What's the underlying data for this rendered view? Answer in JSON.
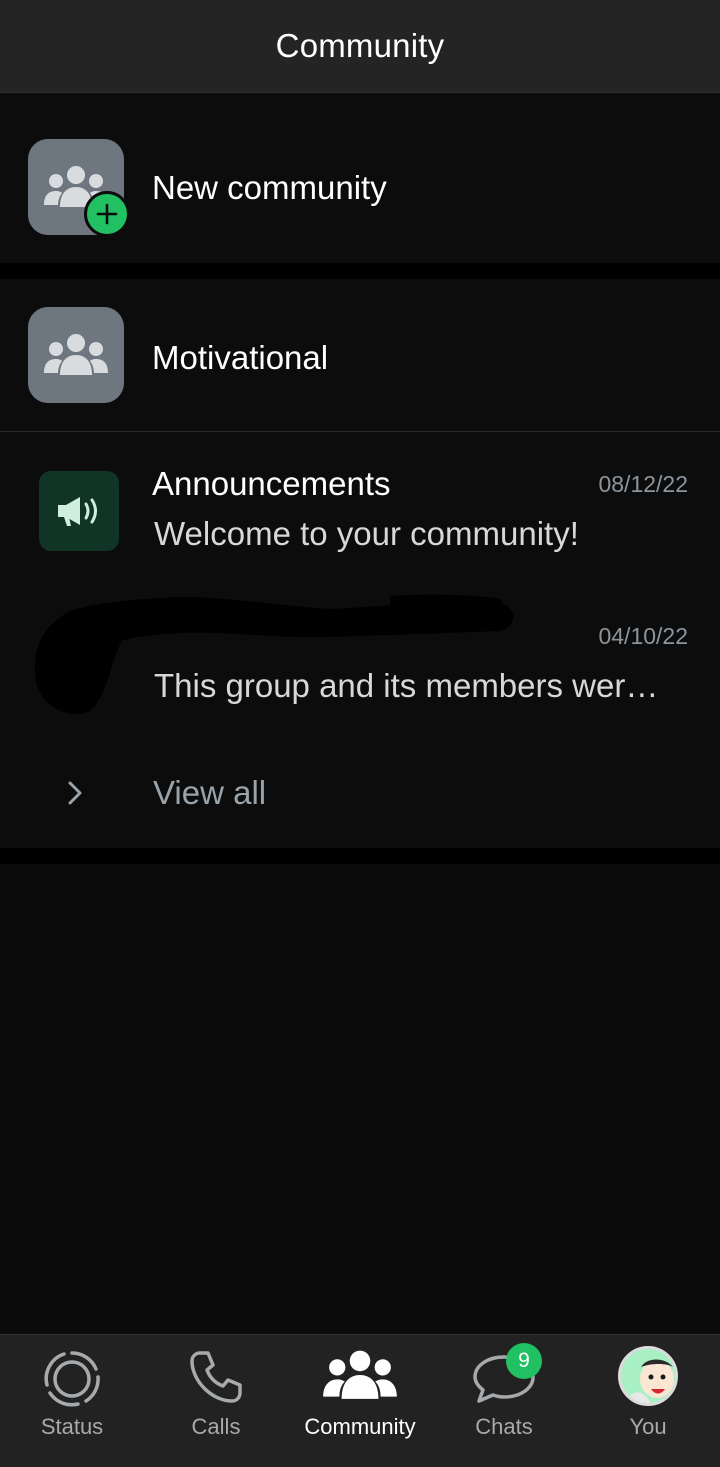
{
  "header": {
    "title": "Community"
  },
  "new_community": {
    "label": "New community",
    "icon": "community-plus-icon"
  },
  "community": {
    "name": "Motivational",
    "groups": [
      {
        "title": "Announcements",
        "date": "08/12/22",
        "message": "Welcome to your community!",
        "icon": "megaphone-icon"
      },
      {
        "title": "",
        "date": "04/10/22",
        "message": "This group and its members wer…"
      }
    ],
    "view_all_label": "View all"
  },
  "bottom_nav": {
    "items": [
      {
        "label": "Status",
        "icon": "status-icon"
      },
      {
        "label": "Calls",
        "icon": "phone-icon"
      },
      {
        "label": "Community",
        "icon": "community-icon",
        "active": true
      },
      {
        "label": "Chats",
        "icon": "chat-icon",
        "badge": "9"
      },
      {
        "label": "You",
        "icon": "profile-avatar"
      }
    ]
  },
  "colors": {
    "accent": "#21c063",
    "header_bg": "#242424",
    "page_bg": "#0b0b0b",
    "muted_text": "#8d959c"
  }
}
